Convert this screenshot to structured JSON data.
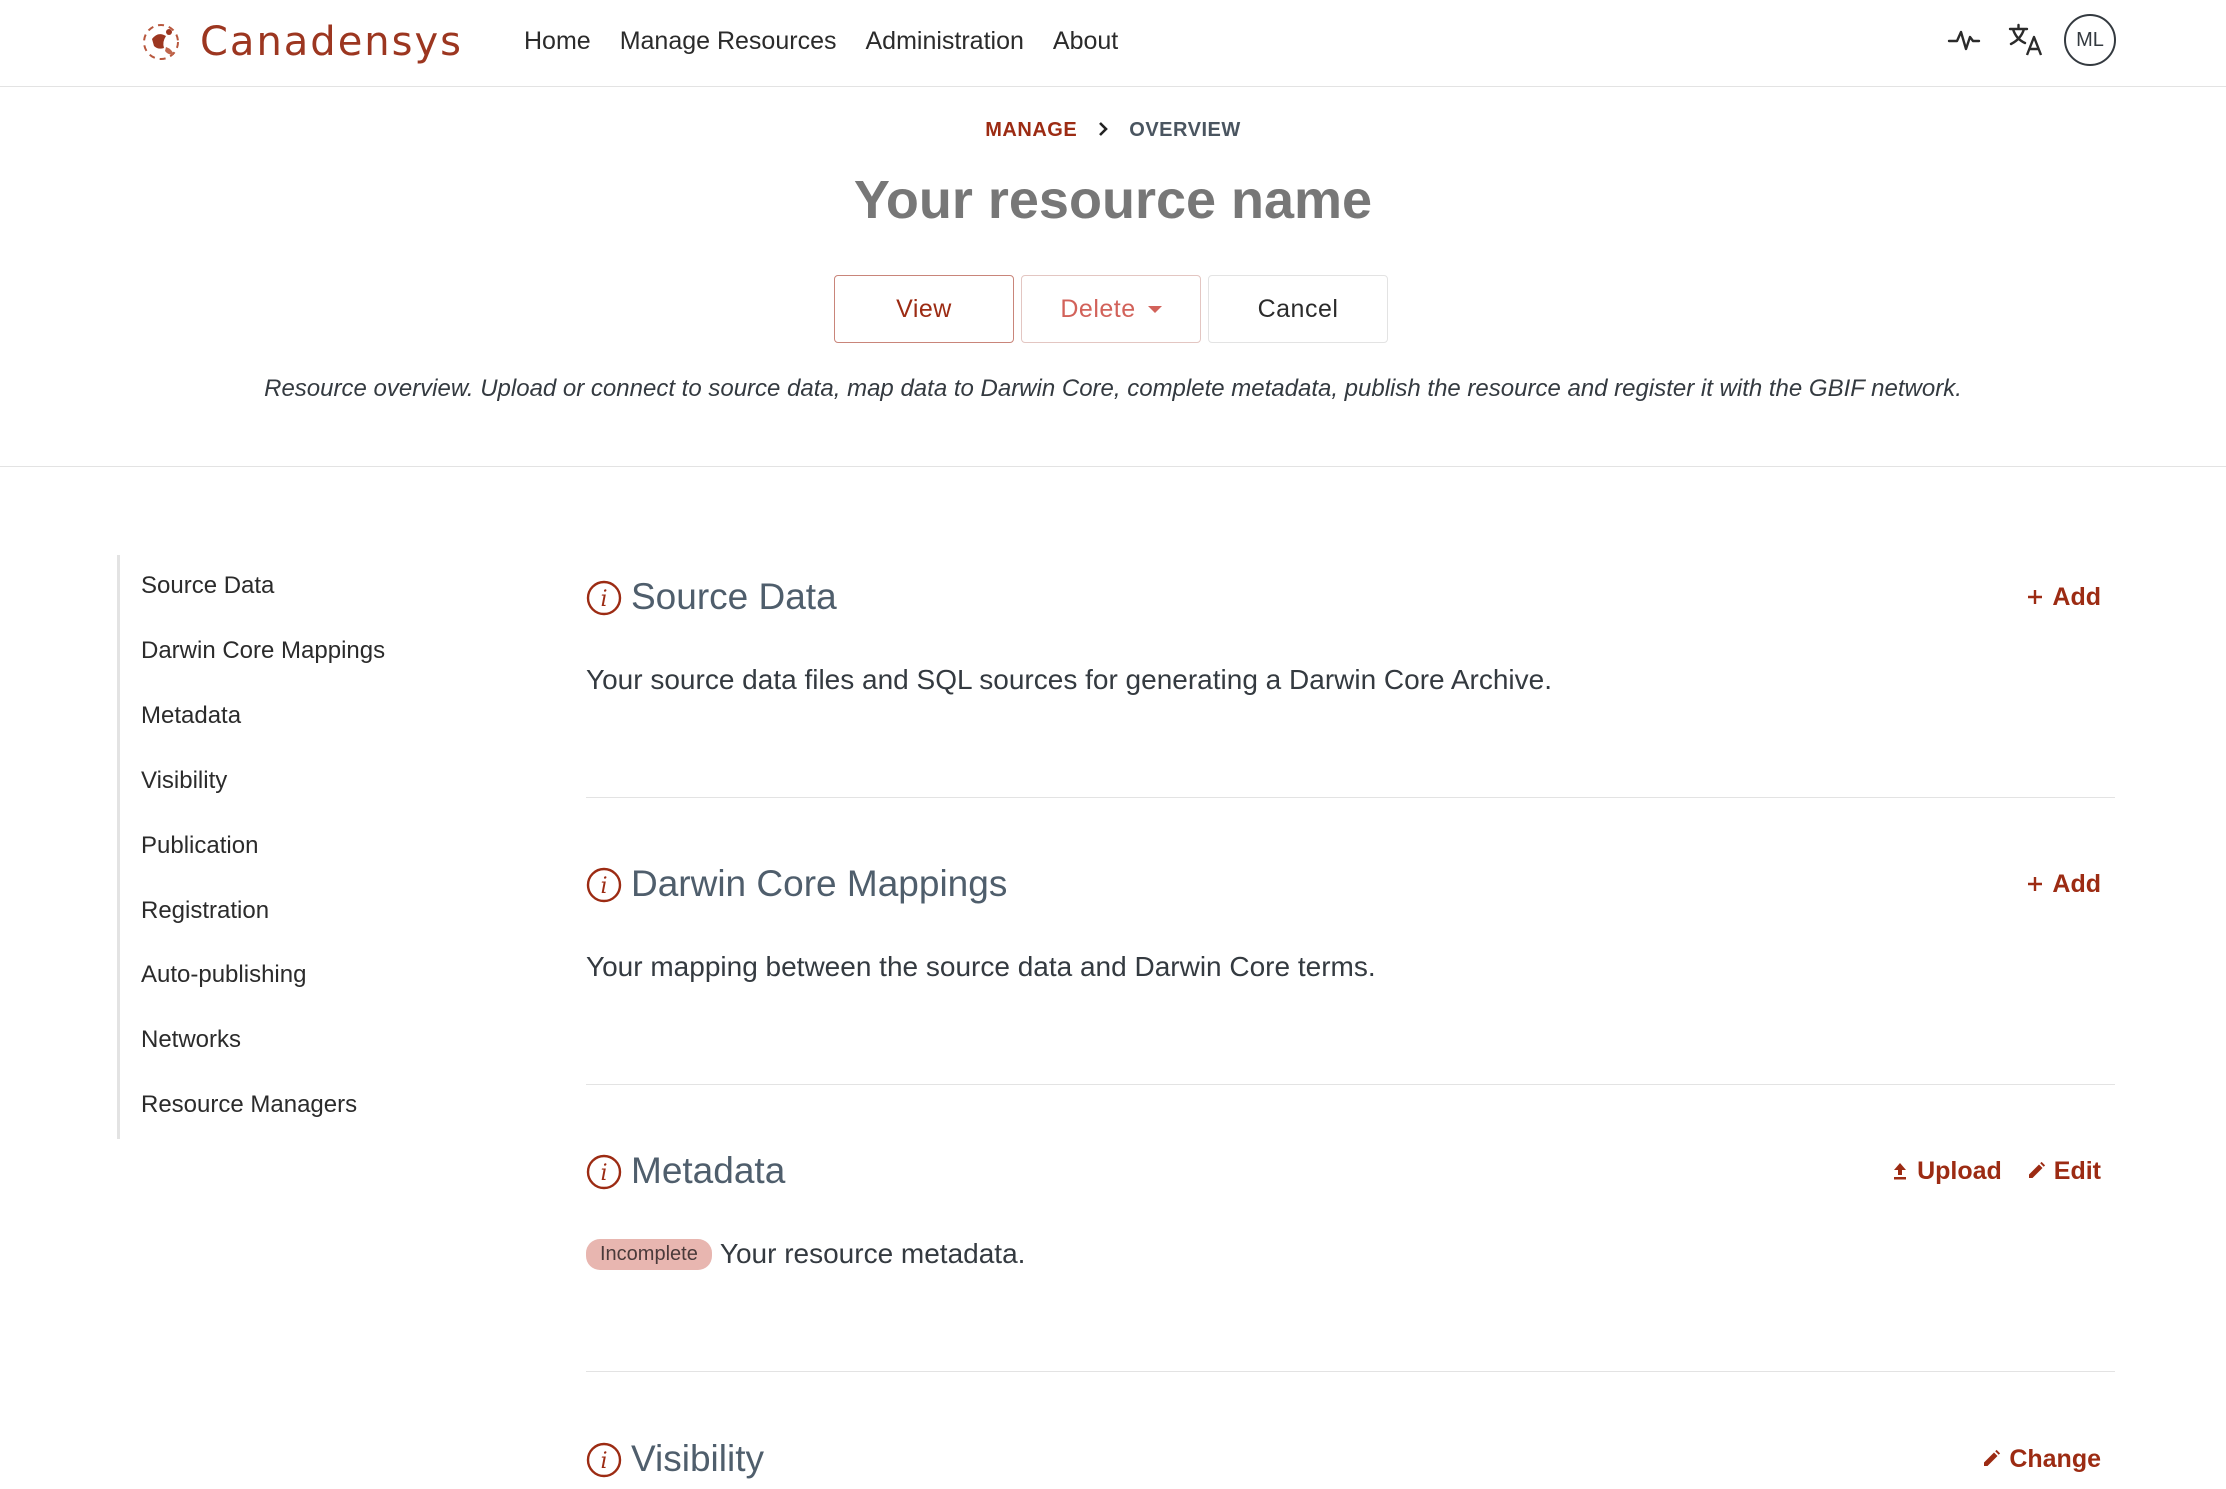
{
  "brand": {
    "name": "Canadensys"
  },
  "nav": {
    "links": [
      "Home",
      "Manage Resources",
      "Administration",
      "About"
    ],
    "avatar_initials": "ML"
  },
  "header": {
    "breadcrumb": {
      "parent": "MANAGE",
      "current": "OVERVIEW"
    },
    "title": "Your resource name",
    "buttons": {
      "view": "View",
      "delete": "Delete",
      "cancel": "Cancel"
    },
    "intro": "Resource overview. Upload or connect to source data, map data to Darwin Core, complete metadata, publish the resource and register it with the GBIF network."
  },
  "sidebar": {
    "items": [
      "Source Data",
      "Darwin Core Mappings",
      "Metadata",
      "Visibility",
      "Publication",
      "Registration",
      "Auto-publishing",
      "Networks",
      "Resource Managers"
    ]
  },
  "sections": {
    "source_data": {
      "title": "Source Data",
      "action": "Add",
      "description": "Your source data files and SQL sources for generating a Darwin Core Archive."
    },
    "mappings": {
      "title": "Darwin Core Mappings",
      "action": "Add",
      "description": "Your mapping between the source data and Darwin Core terms."
    },
    "metadata": {
      "title": "Metadata",
      "action_upload": "Upload",
      "action_edit": "Edit",
      "badge": "Incomplete",
      "description": "Your resource metadata."
    },
    "visibility": {
      "title": "Visibility",
      "action": "Change"
    }
  },
  "colors": {
    "brand": "#9c2b13",
    "section_title": "#4f5e6c",
    "badge_bg": "#e8b6b0",
    "divider": "#e3e3e3"
  },
  "icons": {
    "logo": "canadensys-logo-icon",
    "activity": "activity-pulse-icon",
    "translate": "translate-icon",
    "info": "info-circle-icon",
    "plus": "plus-icon",
    "upload": "upload-icon",
    "edit": "pencil-icon",
    "breadcrumb_sep": "chevron-right-icon",
    "caret": "caret-down-icon"
  }
}
